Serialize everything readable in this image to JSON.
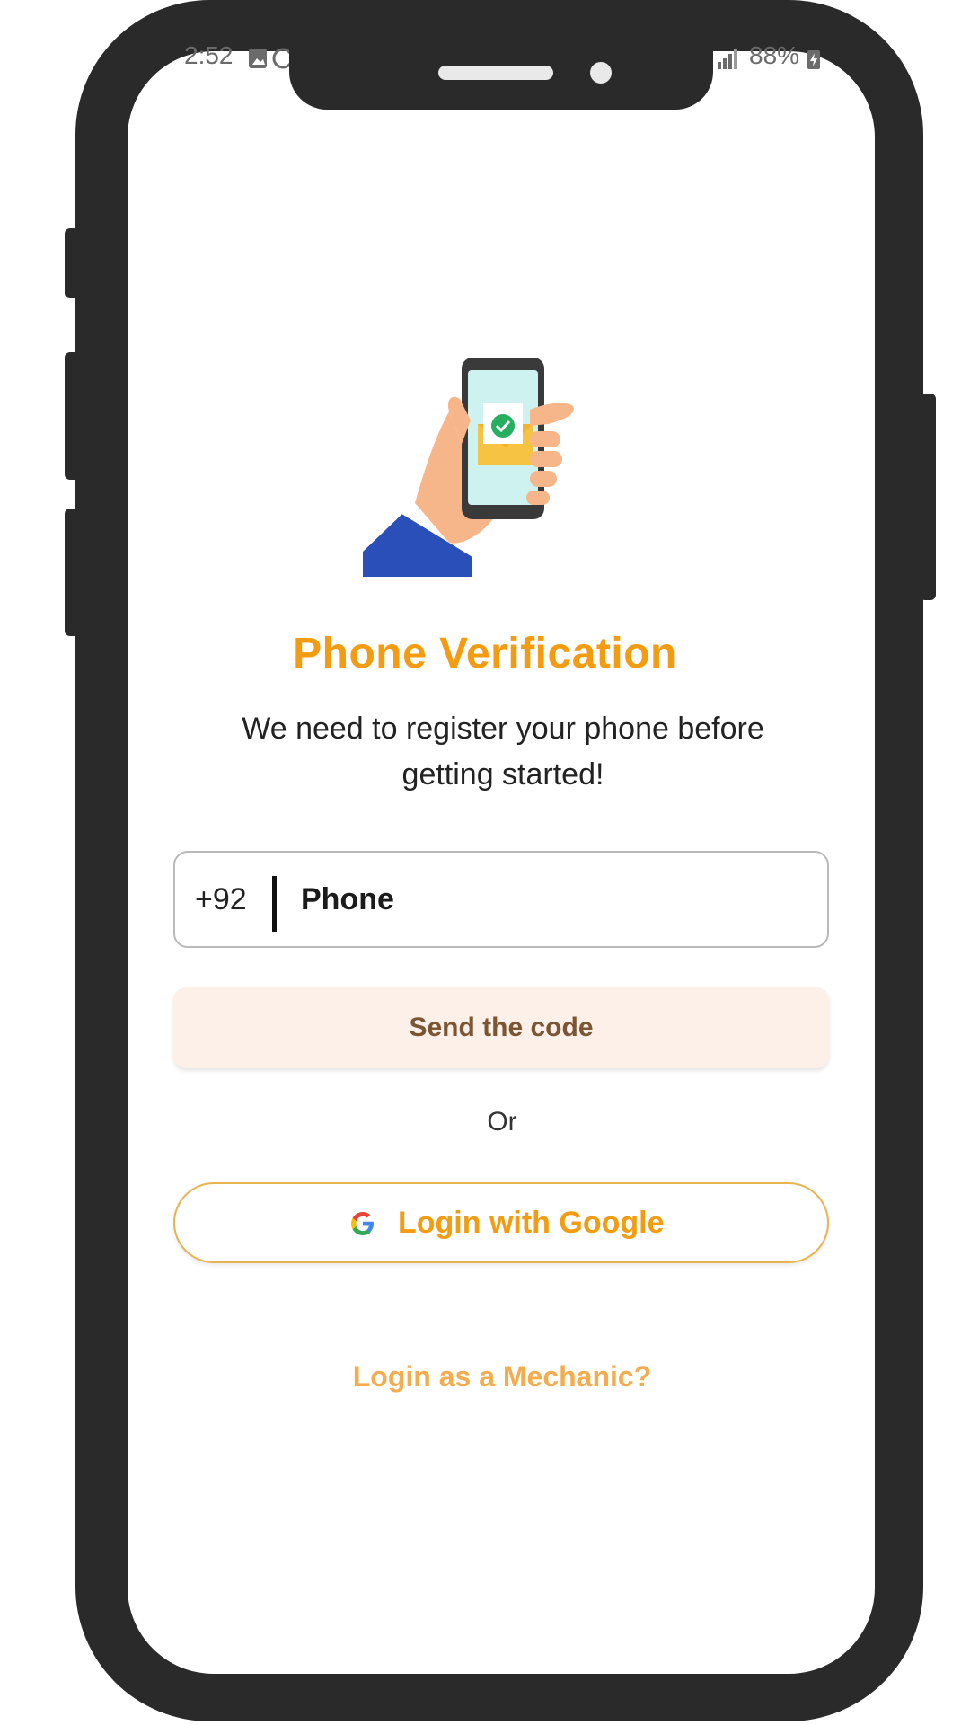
{
  "status_bar": {
    "time": "2:52",
    "battery": "88%"
  },
  "screen": {
    "title": "Phone Verification",
    "subtitle": "We need to register your phone before getting started!",
    "phone_input": {
      "country_code": "+92",
      "placeholder": "Phone"
    },
    "send_button_label": "Send the code",
    "or_label": "Or",
    "google_button_label": "Login with Google",
    "mechanic_link": "Login as a Mechanic?"
  },
  "colors": {
    "accent": "#f39c12",
    "send_button_bg": "#fdf0e8",
    "send_button_text": "#7a5634",
    "google_border": "#e8b44f",
    "link": "#f4ad4e",
    "frame": "#2a2a2a"
  },
  "icons": {
    "illustration": "hand-holding-phone-with-envelope-icon",
    "google": "google-g-icon"
  }
}
